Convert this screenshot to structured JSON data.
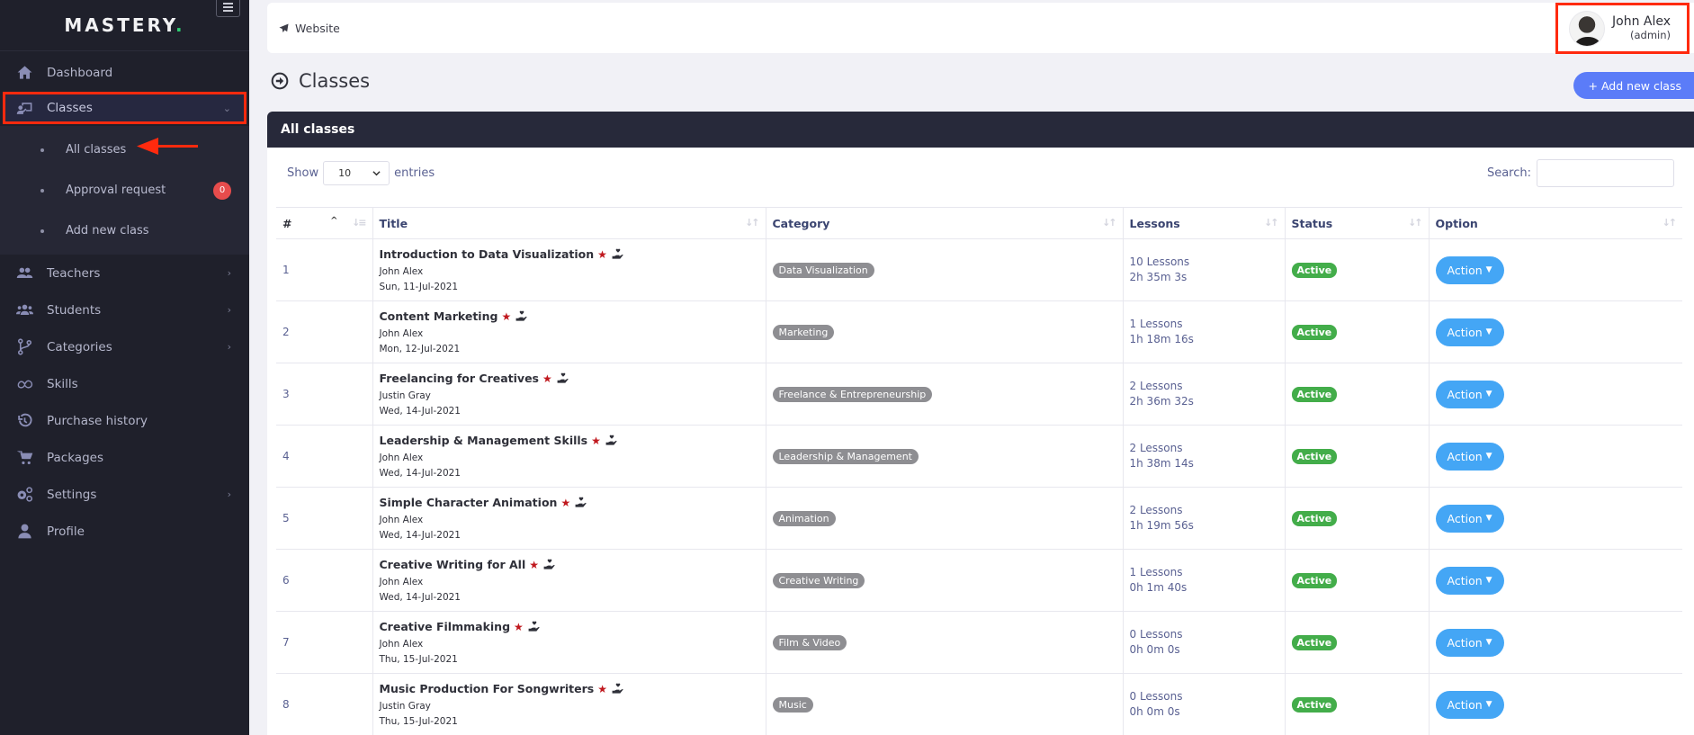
{
  "brand": {
    "name": "MASTERY",
    "dot": "."
  },
  "sidebar": {
    "items": [
      {
        "label": "Dashboard",
        "icon": "home-icon",
        "has_chevron": false
      },
      {
        "label": "Classes",
        "icon": "chalkboard-teacher-icon",
        "has_chevron": true,
        "active": true,
        "submenu": [
          {
            "label": "All classes"
          },
          {
            "label": "Approval request",
            "badge": "0"
          },
          {
            "label": "Add new class"
          }
        ]
      },
      {
        "label": "Teachers",
        "icon": "user-friends-icon",
        "has_chevron": true
      },
      {
        "label": "Students",
        "icon": "users-icon",
        "has_chevron": true
      },
      {
        "label": "Categories",
        "icon": "code-branch-icon",
        "has_chevron": true
      },
      {
        "label": "Skills",
        "icon": "infinity-icon",
        "has_chevron": false
      },
      {
        "label": "Purchase history",
        "icon": "history-icon",
        "has_chevron": false
      },
      {
        "label": "Packages",
        "icon": "shopping-cart-icon",
        "has_chevron": false
      },
      {
        "label": "Settings",
        "icon": "cogs-icon",
        "has_chevron": true
      },
      {
        "label": "Profile",
        "icon": "user-icon",
        "has_chevron": false
      }
    ]
  },
  "topbar": {
    "website_label": "Website",
    "user": {
      "name": "John Alex",
      "role": "(admin)"
    }
  },
  "page": {
    "title": "Classes",
    "add_button": "+ Add new class"
  },
  "card": {
    "title": "All classes",
    "show_label": "Show",
    "entries_label": "entries",
    "page_size": "10",
    "search_label": "Search:",
    "search_value": ""
  },
  "table": {
    "columns": [
      "#",
      "Title",
      "Category",
      "Lessons",
      "Status",
      "Option"
    ],
    "rows": [
      {
        "num": "1",
        "title": "Introduction to Data Visualization",
        "author": "John Alex",
        "date": "Sun, 11-Jul-2021",
        "category": "Data Visualization",
        "lessons": "10 Lessons",
        "duration": "2h 35m 3s",
        "status": "Active",
        "action": "Action"
      },
      {
        "num": "2",
        "title": "Content Marketing",
        "author": "John Alex",
        "date": "Mon, 12-Jul-2021",
        "category": "Marketing",
        "lessons": "1 Lessons",
        "duration": "1h 18m 16s",
        "status": "Active",
        "action": "Action"
      },
      {
        "num": "3",
        "title": "Freelancing for Creatives",
        "author": "Justin Gray",
        "date": "Wed, 14-Jul-2021",
        "category": "Freelance & Entrepreneurship",
        "lessons": "2 Lessons",
        "duration": "2h 36m 32s",
        "status": "Active",
        "action": "Action"
      },
      {
        "num": "4",
        "title": "Leadership & Management Skills",
        "author": "John Alex",
        "date": "Wed, 14-Jul-2021",
        "category": "Leadership & Management",
        "lessons": "2 Lessons",
        "duration": "1h 38m 14s",
        "status": "Active",
        "action": "Action"
      },
      {
        "num": "5",
        "title": "Simple Character Animation",
        "author": "John Alex",
        "date": "Wed, 14-Jul-2021",
        "category": "Animation",
        "lessons": "2 Lessons",
        "duration": "1h 19m 56s",
        "status": "Active",
        "action": "Action"
      },
      {
        "num": "6",
        "title": "Creative Writing for All",
        "author": "John Alex",
        "date": "Wed, 14-Jul-2021",
        "category": "Creative Writing",
        "lessons": "1 Lessons",
        "duration": "0h 1m 40s",
        "status": "Active",
        "action": "Action"
      },
      {
        "num": "7",
        "title": "Creative Filmmaking",
        "author": "John Alex",
        "date": "Thu, 15-Jul-2021",
        "category": "Film & Video",
        "lessons": "0 Lessons",
        "duration": "0h 0m 0s",
        "status": "Active",
        "action": "Action"
      },
      {
        "num": "8",
        "title": "Music Production For Songwriters",
        "author": "Justin Gray",
        "date": "Thu, 15-Jul-2021",
        "category": "Music",
        "lessons": "0 Lessons",
        "duration": "0h 0m 0s",
        "status": "Active",
        "action": "Action"
      }
    ]
  },
  "colors": {
    "sidebar_bg": "#1f202b",
    "card_header_bg": "#27293a",
    "primary": "#5b7cf8",
    "action": "#44a6f5",
    "status_active": "#43ad4a",
    "annotation": "#ff2a0e",
    "featured_star": "#c0181e"
  }
}
